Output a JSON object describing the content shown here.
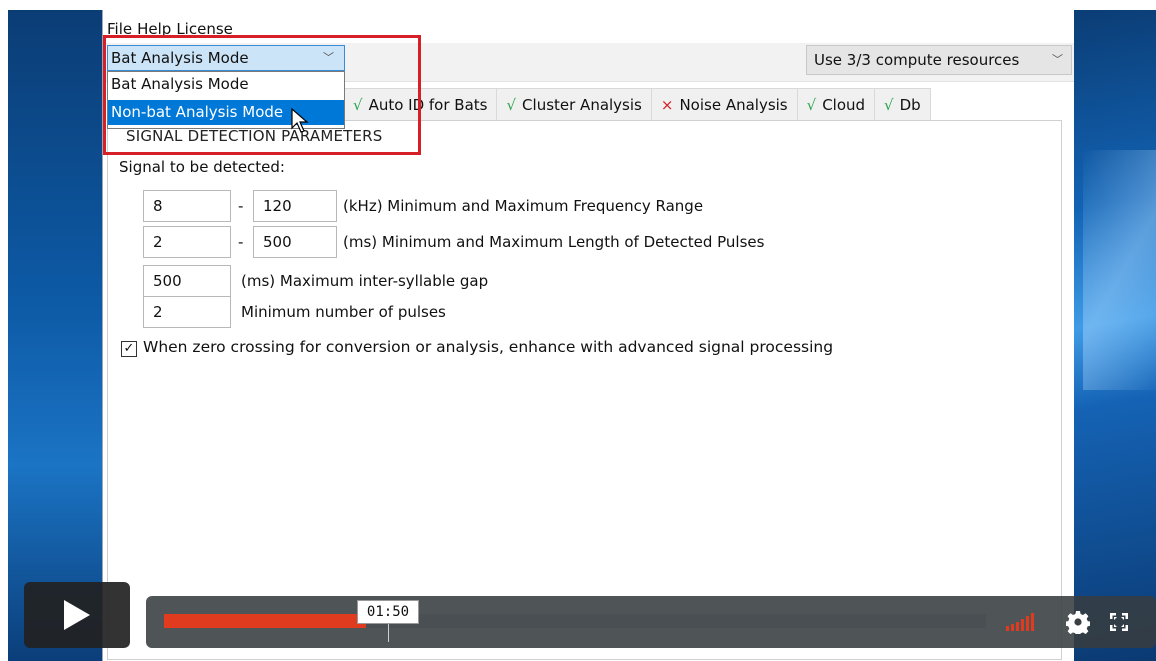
{
  "menu": [
    "File",
    "Help",
    "License"
  ],
  "mode_select": {
    "value": "Bat Analysis Mode",
    "options": [
      "Bat Analysis Mode",
      "Non-bat Analysis Mode"
    ],
    "highlighted": "Non-bat Analysis Mode"
  },
  "compute_select": {
    "value": "Use 3/3 compute resources"
  },
  "tabs": [
    {
      "status": "ok",
      "mark": "√",
      "label": "Auto ID for Bats"
    },
    {
      "status": "ok",
      "mark": "√",
      "label": "Cluster Analysis"
    },
    {
      "status": "bad",
      "mark": "×",
      "label": "Noise Analysis"
    },
    {
      "status": "ok",
      "mark": "√",
      "label": "Cloud"
    },
    {
      "status": "ok",
      "mark": "√",
      "label": "Db"
    }
  ],
  "partial_tab_text": "s",
  "group_title": "SIGNAL DETECTION PARAMETERS",
  "signal_label": "Signal to be detected:",
  "freq": {
    "min": "8",
    "max": "120",
    "desc": "(kHz) Minimum and Maximum Frequency Range"
  },
  "length": {
    "min": "2",
    "max": "500",
    "desc": "(ms) Minimum and Maximum Length of Detected Pulses"
  },
  "gap": {
    "value": "500",
    "desc": "(ms) Maximum inter-syllable gap"
  },
  "pulses": {
    "value": "2",
    "desc": "Minimum number of pulses"
  },
  "dash": "-",
  "checkbox": {
    "checked": true,
    "mark": "✓",
    "label": "When zero crossing for conversion or analysis, enhance with advanced signal processing"
  },
  "video": {
    "time": "01:50",
    "progress": 0.246,
    "accent": "#e03a1f"
  }
}
